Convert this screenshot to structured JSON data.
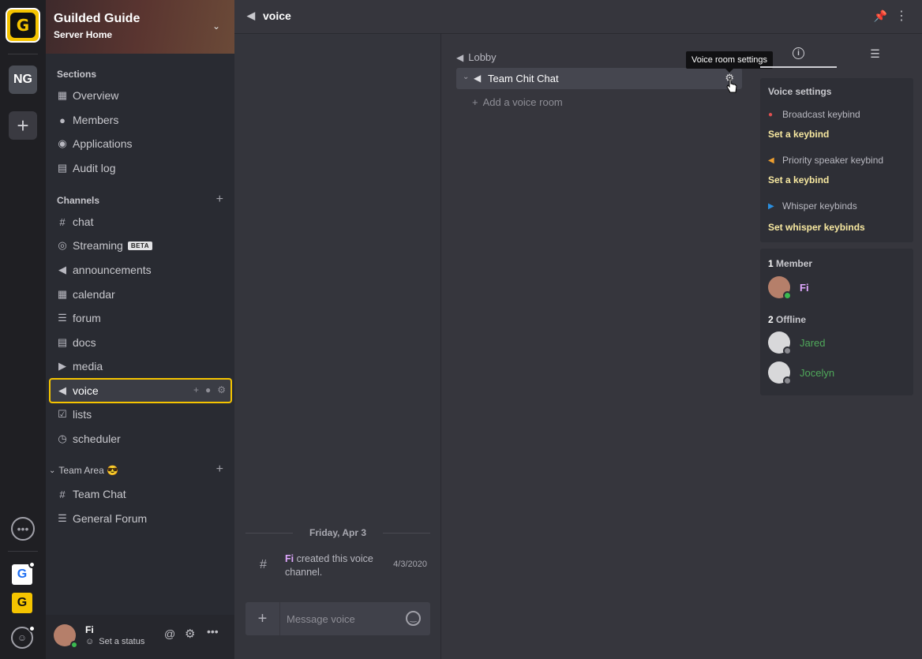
{
  "rail": {
    "server_logo": "G",
    "server_initials": "NG",
    "add_server": "+",
    "icons": [
      "chat-bubble-icon",
      "guilded-blue-icon",
      "guilded-yellow-icon",
      "community-icon"
    ]
  },
  "server": {
    "name": "Guilded Guide",
    "subtitle": "Server Home"
  },
  "sections": {
    "label": "Sections",
    "items": [
      {
        "label": "Overview",
        "icon": "overview-icon",
        "glyph": "▦"
      },
      {
        "label": "Members",
        "icon": "members-icon",
        "glyph": "👥"
      },
      {
        "label": "Applications",
        "icon": "applications-icon",
        "glyph": "👤"
      },
      {
        "label": "Audit log",
        "icon": "audit-log-icon",
        "glyph": "📋"
      }
    ]
  },
  "channels": {
    "label": "Channels",
    "items": [
      {
        "label": "chat",
        "glyph": "#"
      },
      {
        "label": "Streaming",
        "glyph": "((•))",
        "badge": "BETA"
      },
      {
        "label": "announcements",
        "glyph": "📣"
      },
      {
        "label": "calendar",
        "glyph": "▦"
      },
      {
        "label": "forum",
        "glyph": "☰"
      },
      {
        "label": "docs",
        "glyph": "▤"
      },
      {
        "label": "media",
        "glyph": "▶"
      },
      {
        "label": "voice",
        "glyph": "🔈"
      },
      {
        "label": "lists",
        "glyph": "☑"
      },
      {
        "label": "scheduler",
        "glyph": "◷"
      }
    ]
  },
  "team_area": {
    "label": "Team Area 😎",
    "items": [
      {
        "label": "Team Chat",
        "glyph": "#"
      },
      {
        "label": "General Forum",
        "glyph": "☰"
      }
    ]
  },
  "footer": {
    "user_name": "Fi",
    "status": "Set a status"
  },
  "topbar": {
    "title": "voice"
  },
  "chat": {
    "date": "Friday, Apr 3",
    "message_author": "Fi",
    "message_text": " created this voice channel.",
    "message_time": "4/3/2020",
    "composer_placeholder": "Message voice"
  },
  "voice": {
    "lobby": "Lobby",
    "room_name": "Team Chit Chat",
    "add_room": "Add a voice room",
    "tooltip": "Voice room settings"
  },
  "right_panel": {
    "settings_title": "Voice settings",
    "broadcast_label": "Broadcast keybind",
    "broadcast_action": "Set a keybind",
    "priority_label": "Priority speaker keybind",
    "priority_action": "Set a keybind",
    "whisper_label": "Whisper keybinds",
    "whisper_action": "Set whisper keybinds",
    "members_count": "1",
    "members_label": "Member",
    "online_member": "Fi",
    "offline_count": "2",
    "offline_label": "Offline",
    "offline_members": [
      "Jared",
      "Jocelyn"
    ]
  },
  "colors": {
    "accent": "#f5c400",
    "online": "#3bba50",
    "offline_name": "#4fa85a",
    "member_name": "#e0a8ff"
  }
}
